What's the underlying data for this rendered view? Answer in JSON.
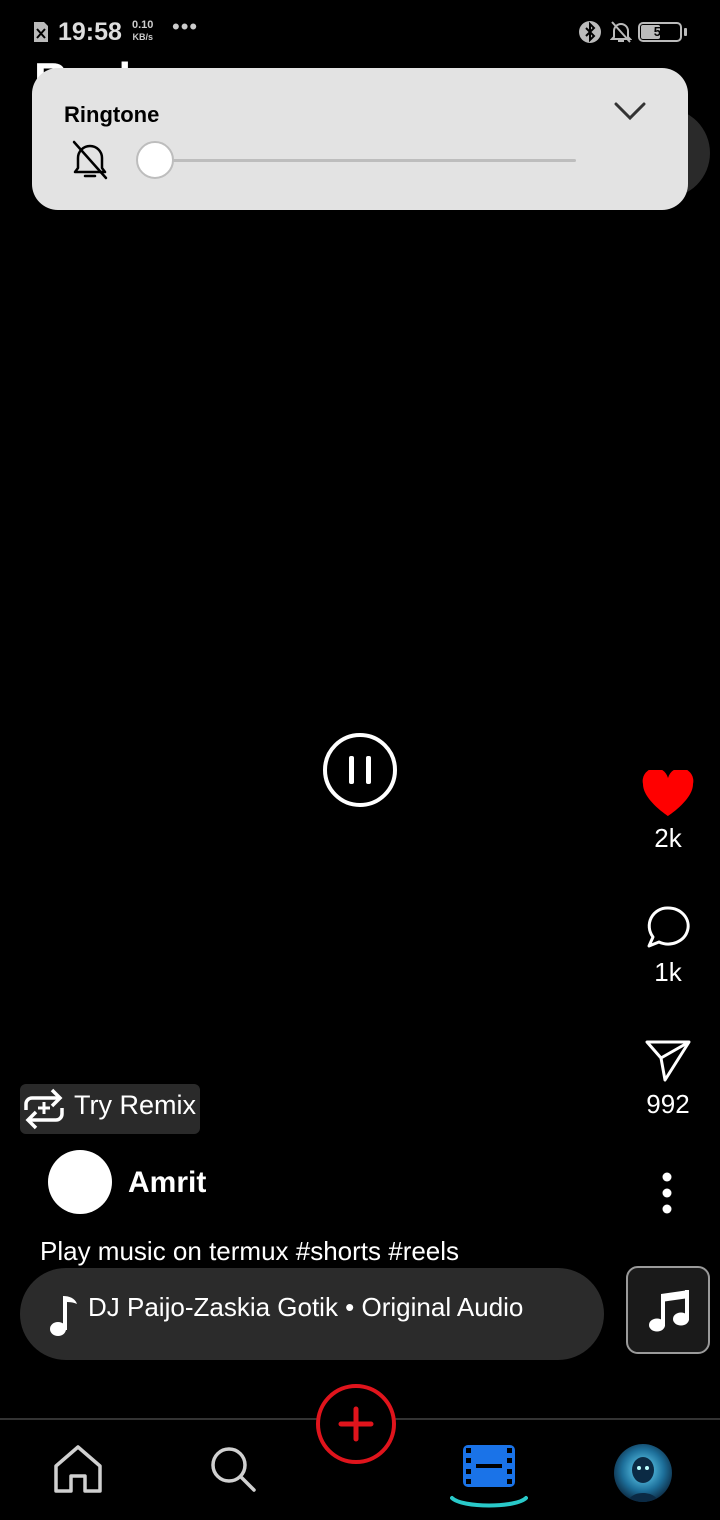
{
  "status_bar": {
    "time": "19:58",
    "speed_value": "0.10",
    "speed_unit": "KB/s",
    "more": "•••",
    "battery": "53",
    "icons": [
      "sim-icon",
      "bluetooth-icon",
      "silent-bell-icon",
      "battery-icon"
    ]
  },
  "page": {
    "title": "Reels"
  },
  "volume_popup": {
    "title": "Ringtone",
    "level_fraction": 0.0,
    "icons": [
      "bell-off-icon",
      "chevron-down-icon"
    ]
  },
  "reel": {
    "likes": "2k",
    "comments": "1k",
    "shares": "992",
    "remix_label": "Try Remix",
    "username": "Amrit",
    "caption": "Play music on termux #shorts #reels",
    "audio": "DJ Paijo-Zaskia Gotik • Original Audio"
  },
  "nav": {
    "items": [
      "home",
      "search",
      "create",
      "reels",
      "profile"
    ],
    "active": "reels"
  },
  "colors": {
    "like": "#ff0000",
    "create": "#e0141c",
    "reels_active": "#1a73e8",
    "reels_underline": "#29c9c9"
  }
}
